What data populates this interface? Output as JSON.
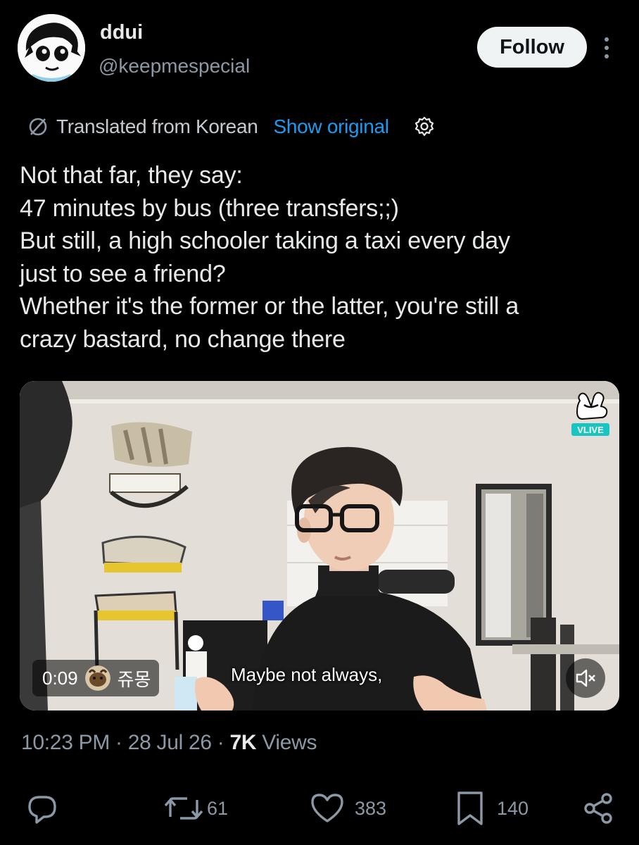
{
  "author": {
    "display_name": "ddui",
    "handle": "@keepmespecial",
    "follow_label": "Follow"
  },
  "translation": {
    "label": "Translated from Korean",
    "show_original_label": "Show original"
  },
  "tweet": {
    "lines": [
      "Not that far, they say:",
      "47 minutes by bus (three transfers;;)",
      "But still, a high schooler taking a taxi every day",
      "just to see a friend?",
      "Whether it's the former or the latter, you're still a",
      "crazy bastard, no change there"
    ]
  },
  "media": {
    "timestamp": "0:09",
    "channel_name": "쥬몽",
    "caption": "Maybe not always,",
    "watermark": "VLIVE"
  },
  "meta": {
    "time": "10:23 PM",
    "separator": "·",
    "date": "28 Jul 26",
    "views_count": "7K",
    "views_label": "Views"
  },
  "actions": {
    "reply_icon": "reply-icon",
    "retweet_count": "61",
    "like_count": "383",
    "bookmark_count": "140",
    "share_icon": "share-icon"
  },
  "colors": {
    "background": "#000000",
    "text_primary": "#e7e9ea",
    "text_secondary": "#8b98a5",
    "link": "#1d9bf0",
    "follow_bg": "#eff3f4"
  }
}
